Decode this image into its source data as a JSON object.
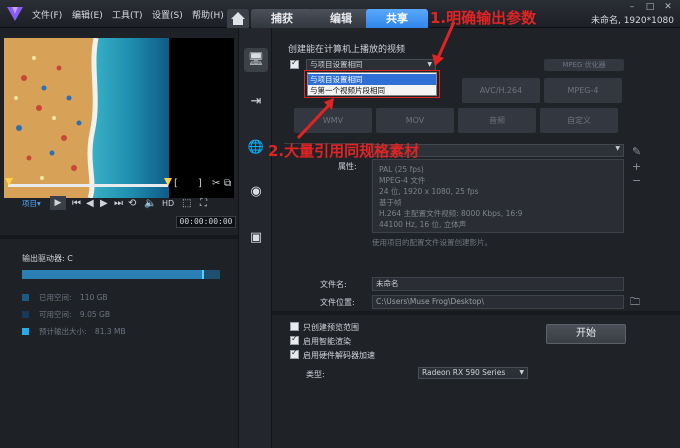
{
  "menubar": {
    "file": "文件(F)",
    "edit": "编辑(E)",
    "tools": "工具(T)",
    "settings": "设置(S)",
    "help": "帮助(H)",
    "title_info": "未命名, 1920*1080"
  },
  "tabs": [
    {
      "label": "捕获"
    },
    {
      "label": "编辑"
    },
    {
      "label": "共享"
    }
  ],
  "player": {
    "bracket_open": "[",
    "bracket_close": "]",
    "project_label": "项目▾",
    "hd": "HD",
    "timecode": "00:00:00:00"
  },
  "drive": {
    "label": "输出驱动器: C",
    "used_fraction": 0.92,
    "legend": [
      {
        "label": "已用空间:",
        "value": "110 GB",
        "color": "#1e5a80"
      },
      {
        "label": "可用空间:",
        "value": "9.05 GB",
        "color": "#15395a"
      },
      {
        "label": "预计输出大小:",
        "value": "81.3 MB",
        "color": "#2aa9e8"
      }
    ]
  },
  "main": {
    "section_title": "创建能在计算机上播放的视频",
    "combo_value": "与项目设置相同",
    "dropdown_options": [
      "与项目设置相同",
      "与第一个视频片段相同"
    ],
    "mpeg_opt": "MPEG 优化器",
    "formats_row1": [
      "AVC/H.264",
      "MPEG-4"
    ],
    "formats_row2": [
      "WMV",
      "MOV",
      "音频",
      "自定义"
    ],
    "properties_label": "属性:",
    "properties": [
      "PAL (25 fps)",
      "MPEG-4 文件",
      "24 位, 1920 x 1080, 25 fps",
      "基于帧",
      "H.264 主配置文件视频: 8000 Kbps, 16:9",
      "44100 Hz, 16 位, 立体声"
    ],
    "hint": "使用项目的配置文件设置创建影片。",
    "filename_label": "文件名:",
    "filename_value": "未命名",
    "location_label": "文件位置:",
    "location_value": "C:\\Users\\Muse Frog\\Desktop\\",
    "opt_preview": "只创建预览范围",
    "opt_smart": "启用智能渲染",
    "opt_hw": "启用硬件解码器加速",
    "type_label": "类型:",
    "type_value": "Radeon RX 590 Series",
    "start_label": "开始"
  },
  "annotations": {
    "a1": "1.明确输出参数",
    "a2": "2.大量引用同规格素材"
  },
  "colors": {
    "accent": "#2f86e8",
    "annotation": "#e02424"
  }
}
